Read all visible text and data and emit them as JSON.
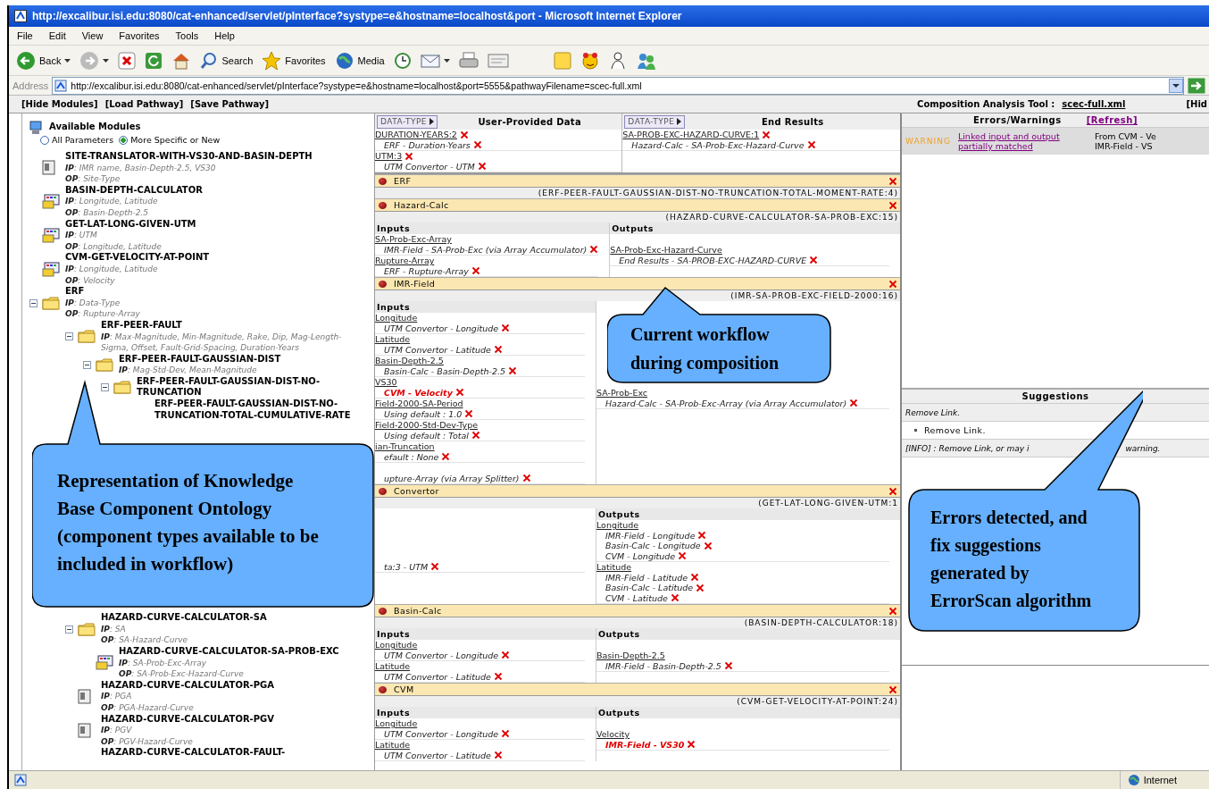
{
  "window": {
    "title": "http://excalibur.isi.edu:8080/cat-enhanced/servlet/pInterface?systype=e&hostname=localhost&port - Microsoft Internet Explorer"
  },
  "menu": [
    "File",
    "Edit",
    "View",
    "Favorites",
    "Tools",
    "Help"
  ],
  "toolbar": [
    {
      "kind": "back",
      "label": "Back"
    },
    {
      "kind": "forward"
    },
    {
      "kind": "stop"
    },
    {
      "kind": "refresh"
    },
    {
      "kind": "home"
    },
    {
      "kind": "search",
      "label": "Search"
    },
    {
      "kind": "favorites",
      "label": "Favorites"
    },
    {
      "kind": "media",
      "label": "Media"
    },
    {
      "kind": "history"
    },
    {
      "kind": "mail"
    },
    {
      "kind": "print"
    },
    {
      "kind": "edit"
    },
    {
      "kind": "note"
    },
    {
      "kind": "cartoon"
    },
    {
      "kind": "person"
    },
    {
      "kind": "people"
    }
  ],
  "address": {
    "label": "Address",
    "url": "http://excalibur.isi.edu:8080/cat-enhanced/servlet/pInterface?systype=e&hostname=localhost&port=5555&pathwayFilename=scec-full.xml"
  },
  "app_bar": {
    "links": [
      "[Hide Modules]",
      "[Load Pathway]",
      "[Save Pathway]"
    ],
    "tool_label": "Composition Analysis Tool :",
    "file": "scec-full.xml",
    "right_link": "[Hid"
  },
  "modules_panel": {
    "title": "Available Modules",
    "filters": [
      {
        "label": "All Parameters",
        "selected": false
      },
      {
        "label": "More Specific or New",
        "selected": true
      }
    ],
    "tree": [
      {
        "name": "SITE-TRANSLATOR-WITH-VS30-AND-BASIN-DEPTH",
        "kind": "document",
        "ip": "**IP**: IMR name, Basin-Depth-2.5, VS30",
        "op": "**OP**: Site-Type"
      },
      {
        "name": "BASIN-DEPTH-CALCULATOR",
        "kind": "module",
        "ip": "**IP**: Longitude, Latitude",
        "op": "**OP**: Basin-Depth-2.5"
      },
      {
        "name": "GET-LAT-LONG-GIVEN-UTM",
        "kind": "module",
        "ip": "**IP**: UTM",
        "op": "**OP**: Longitude, Latitude"
      },
      {
        "name": "CVM-GET-VELOCITY-AT-POINT",
        "kind": "module",
        "ip": "**IP**: Longitude, Latitude",
        "op": "**OP**: Velocity"
      },
      {
        "name": "ERF",
        "kind": "folder",
        "expanded": true,
        "ip": "**IP**: Data-Type",
        "op": "**OP**: Rupture-Array",
        "children": [
          {
            "name": "ERF-PEER-FAULT",
            "kind": "folder",
            "expanded": true,
            "ip": "**IP**: Max-Magnitude, Min-Magnitude, Rake, Dip, Mag-Length-Sigma, Offset, Fault-Grid-Spacing, Duration-Years",
            "children": [
              {
                "name": "ERF-PEER-FAULT-GAUSSIAN-DIST",
                "kind": "folder",
                "expanded": true,
                "ip": "**IP**: Mag-Std-Dev, Mean-Magnitude",
                "children": [
                  {
                    "name": "ERF-PEER-FAULT-GAUSSIAN-DIST-NO-TRUNCATION",
                    "kind": "folder",
                    "expanded": true,
                    "children": [
                      {
                        "name": "ERF-PEER-FAULT-GAUSSIAN-DIST-NO-TRUNCATION-TOTAL-CUMULATIVE-RATE"
                      }
                    ]
                  }
                ]
              }
            ]
          }
        ]
      },
      {
        "children": [
          {
            "name": "HAZARD-CURVE-CALCULATOR-SA",
            "kind": "folder",
            "expanded": true,
            "ip": "**IP**: SA",
            "op": "**OP**: SA-Hazard-Curve",
            "children": [
              {
                "name": "HAZARD-CURVE-CALCULATOR-SA-PROB-EXC",
                "kind": "module",
                "ip": "**IP**: SA-Prob-Exc-Array",
                "op": "**OP**: SA-Prob-Exc-Hazard-Curve"
              }
            ]
          },
          {
            "name": "HAZARD-CURVE-CALCULATOR-PGA",
            "kind": "document",
            "ip": "**IP**: PGA",
            "op": "**OP**: PGA-Hazard-Curve"
          },
          {
            "name": "HAZARD-CURVE-CALCULATOR-PGV",
            "kind": "document",
            "ip": "**IP**: PGV",
            "op": "**OP**: PGV-Hazard-Curve"
          },
          {
            "name": "HAZARD-CURVE-CALCULATOR-FAULT-"
          }
        ]
      }
    ]
  },
  "workflow": {
    "columns": [
      {
        "button": "DATA-TYPE",
        "title": "User-Provided Data",
        "items": [
          {
            "name": "DURATION-YEARS:2",
            "links": [
              {
                "text": "ERF - Duration-Years",
                "warning": false
              }
            ]
          },
          {
            "name": "UTM:3",
            "links": [
              {
                "text": "UTM Convertor - UTM",
                "warning": false
              }
            ]
          }
        ]
      },
      {
        "button": "DATA-TYPE",
        "title": "End Results",
        "items": [
          {
            "name": "SA-PROB-EXC-HAZARD-CURVE:1",
            "links": [
              {
                "text": "Hazard-Calc - SA-Prob-Exc-Hazard-Curve",
                "warning": false
              }
            ]
          }
        ]
      }
    ],
    "modules": [
      {
        "name": "ERF",
        "component": "(ERF-PEER-FAULT-GAUSSIAN-DIST-NO-TRUNCATION-TOTAL-MOMENT-RATE:4)"
      },
      {
        "name": "Hazard-Calc",
        "component": "(HAZARD-CURVE-CALCULATOR-SA-PROB-EXC:15)",
        "inputs_label": "Inputs",
        "outputs_label": "Outputs",
        "inputs": [
          {
            "name": "SA-Prob-Exc-Array",
            "links": [
              {
                "text": "IMR-Field - SA-Prob-Exc (via Array Accumulator)",
                "warning": false
              }
            ]
          },
          {
            "name": "Rupture-Array",
            "links": [
              {
                "text": "ERF - Rupture-Array",
                "warning": false
              }
            ]
          }
        ],
        "outputs": [
          {
            "name": "SA-Prob-Exc-Hazard-Curve",
            "links": [
              {
                "text": "End Results - SA-PROB-EXC-HAZARD-CURVE",
                "warning": false
              }
            ]
          }
        ]
      },
      {
        "name": "IMR-Field",
        "component": "(IMR-SA-PROB-EXC-FIELD-2000:16)",
        "inputs_label": "Inputs",
        "inputs": [
          {
            "name": "Longitude",
            "links": [
              {
                "text": "UTM Convertor - Longitude",
                "warning": false
              }
            ]
          },
          {
            "name": "Latitude",
            "links": [
              {
                "text": "UTM Convertor - Latitude",
                "warning": false
              }
            ]
          },
          {
            "name": "Basin-Depth-2.5",
            "links": [
              {
                "text": "Basin-Calc - Basin-Depth-2.5",
                "warning": false
              }
            ]
          },
          {
            "name": "VS30",
            "links": [
              {
                "text": "CVM - Velocity",
                "warning": true
              }
            ]
          },
          {
            "name": "Field-2000-SA-Period",
            "links": [
              {
                "text": "Using default : 1.0",
                "warning": false
              }
            ]
          },
          {
            "name": "Field-2000-Std-Dev-Type",
            "links": [
              {
                "text": "Using default : Total",
                "warning": false
              }
            ]
          },
          {
            "name": "ian-Truncation",
            "links": [
              {
                "text": "efault : None",
                "warning": false
              }
            ]
          },
          {
            "links": [
              {
                "text": "upture-Array (via Array Splitter)",
                "warning": false
              }
            ]
          }
        ],
        "outputs": [
          {
            "name": "SA-Prob-Exc",
            "links": [
              {
                "text": "Hazard-Calc - SA-Prob-Exc-Array (via Array Accumulator)",
                "warning": false
              }
            ]
          }
        ]
      },
      {
        "name": "Convertor",
        "component": "(GET-LAT-LONG-GIVEN-UTM:1",
        "outputs_label": "Outputs",
        "inputs": [
          {
            "links": [
              {
                "text": "ta:3 - UTM",
                "warning": false
              }
            ]
          }
        ],
        "outputs": [
          {
            "name": "Longitude",
            "links": [
              {
                "text": "IMR-Field - Longitude",
                "warning": false
              },
              {
                "text": "Basin-Calc - Longitude",
                "warning": false
              },
              {
                "text": "CVM - Longitude",
                "warning": false
              }
            ]
          },
          {
            "name": "Latitude",
            "links": [
              {
                "text": "IMR-Field - Latitude",
                "warning": false
              },
              {
                "text": "Basin-Calc - Latitude",
                "warning": false
              },
              {
                "text": "CVM - Latitude",
                "warning": false
              }
            ]
          }
        ]
      },
      {
        "name": "Basin-Calc",
        "component": "(BASIN-DEPTH-CALCULATOR:18)",
        "inputs_label": "Inputs",
        "outputs_label": "Outputs",
        "inputs": [
          {
            "name": "Longitude",
            "links": [
              {
                "text": "UTM Convertor - Longitude",
                "warning": false
              }
            ]
          },
          {
            "name": "Latitude",
            "links": [
              {
                "text": "UTM Convertor - Latitude",
                "warning": false
              }
            ]
          }
        ],
        "outputs": [
          {
            "name": "Basin-Depth-2.5",
            "links": [
              {
                "text": "IMR-Field - Basin-Depth-2.5",
                "warning": false
              }
            ]
          }
        ]
      },
      {
        "name": "CVM",
        "component": "(CVM-GET-VELOCITY-AT-POINT:24)",
        "inputs_label": "Inputs",
        "outputs_label": "Outputs",
        "inputs": [
          {
            "name": "Longitude",
            "links": [
              {
                "text": "UTM Convertor - Longitude",
                "warning": false
              }
            ]
          },
          {
            "name": "Latitude",
            "links": [
              {
                "text": "UTM Convertor - Latitude",
                "warning": false
              }
            ]
          }
        ],
        "outputs": [
          {
            "name": "Velocity",
            "links": [
              {
                "text": "IMR-Field - VS30",
                "warning": true
              }
            ]
          }
        ]
      }
    ]
  },
  "diagnostics": {
    "title": "Errors/Warnings",
    "refresh": "[Refresh]",
    "items": [
      {
        "label": "WARNING",
        "message": "Linked input and output partially matched",
        "details": [
          "From CVM - Ve",
          "IMR-Field - VS"
        ]
      }
    ],
    "suggestions_title": "Suggestions",
    "suggestions": [
      {
        "kind": "heading",
        "text": "Remove Link."
      },
      {
        "kind": "bullet",
        "text": "Remove Link."
      },
      {
        "kind": "info",
        "parts": [
          "[INFO] : Remove Link, or may i",
          "warning."
        ]
      }
    ]
  },
  "status_bar": {
    "zone": "Internet"
  },
  "callouts": [
    {
      "text": "Representation of Knowledge Base Component Ontology (component types available to be included in workflow)"
    },
    {
      "text": "Current workflow during composition"
    },
    {
      "text": "Errors detected, and fix suggestions generated by ErrorScan algorithm"
    }
  ]
}
